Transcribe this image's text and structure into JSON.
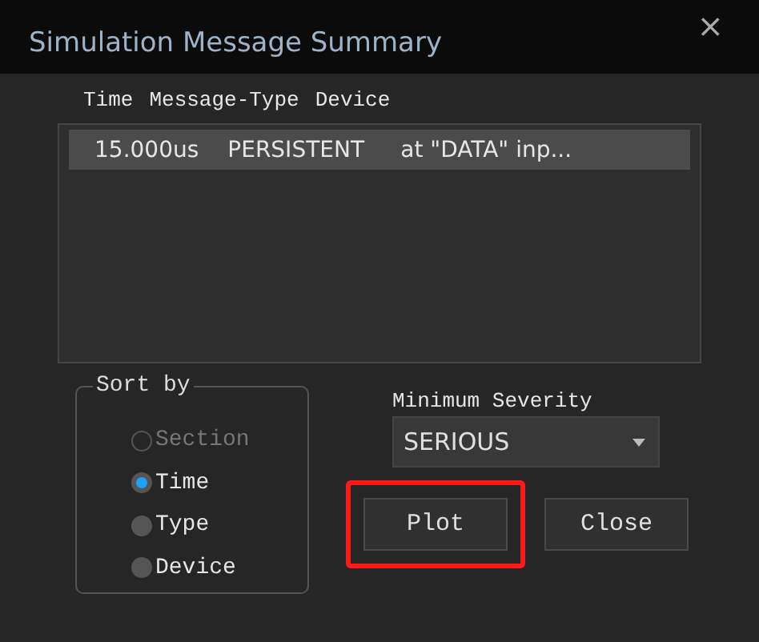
{
  "window": {
    "title": "Simulation Message Summary",
    "close": "×"
  },
  "list": {
    "headings": [
      "Time",
      "Message-Type",
      "Device"
    ],
    "rows": [
      {
        "cells": [
          "15.000us",
          "PERSISTENT",
          "at \"DATA\" inp..."
        ],
        "selected": true
      }
    ]
  },
  "sort_by": {
    "label": "Sort by",
    "options": [
      {
        "label": "Section",
        "selected": false,
        "disabled": true
      },
      {
        "label": "Time",
        "selected": true,
        "disabled": false
      },
      {
        "label": "Type",
        "selected": false,
        "disabled": false
      },
      {
        "label": "Device",
        "selected": false,
        "disabled": false
      }
    ]
  },
  "minimum_severity": {
    "label": "Minimum Severity",
    "value": "SERIOUS"
  },
  "buttons": [
    {
      "label": "Plot",
      "highlighted": true
    },
    {
      "label": "Close",
      "highlighted": false
    }
  ]
}
